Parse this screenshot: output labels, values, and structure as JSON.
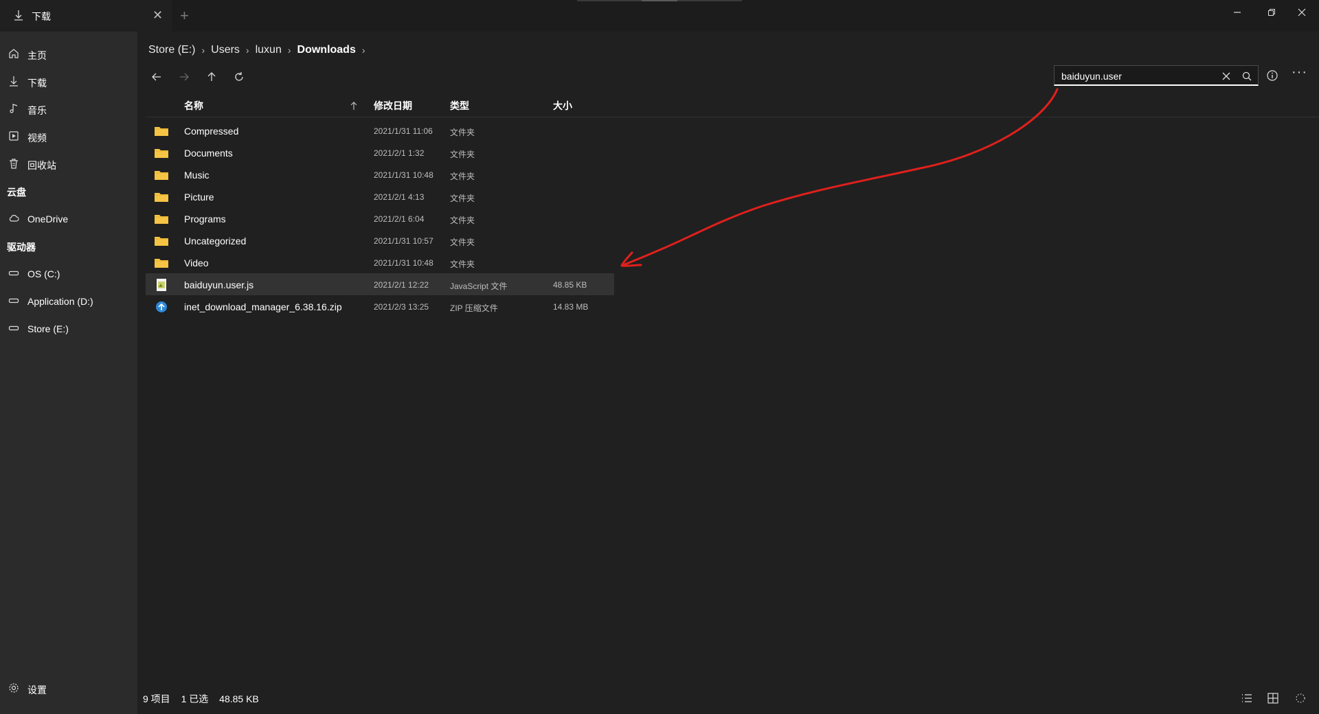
{
  "tab": {
    "title": "下载",
    "icon": "download-icon"
  },
  "window": {
    "minimize": "minimize-icon",
    "maximize": "restore-icon",
    "close": "close-icon"
  },
  "sidebar": {
    "items": [
      {
        "label": "主页",
        "icon": "home-icon"
      },
      {
        "label": "下载",
        "icon": "download-icon"
      },
      {
        "label": "音乐",
        "icon": "music-icon"
      },
      {
        "label": "视频",
        "icon": "video-icon"
      },
      {
        "label": "回收站",
        "icon": "recycle-bin-icon"
      }
    ],
    "cloud_header": "云盘",
    "cloud_items": [
      {
        "label": "OneDrive",
        "icon": "cloud-icon"
      }
    ],
    "drives_header": "驱动器",
    "drive_items": [
      {
        "label": "OS (C:)",
        "icon": "drive-icon"
      },
      {
        "label": "Application (D:)",
        "icon": "drive-icon"
      },
      {
        "label": "Store (E:)",
        "icon": "drive-icon"
      }
    ],
    "settings_label": "设置"
  },
  "breadcrumb": [
    "Store (E:)",
    "Users",
    "luxun",
    "Downloads"
  ],
  "search": {
    "value": "baiduyun.user"
  },
  "columns": {
    "name": "名称",
    "date": "修改日期",
    "type": "类型",
    "size": "大小"
  },
  "files": [
    {
      "name": "Compressed",
      "date": "2021/1/31 11:06",
      "type": "文件夹",
      "size": "",
      "kind": "folder"
    },
    {
      "name": "Documents",
      "date": "2021/2/1 1:32",
      "type": "文件夹",
      "size": "",
      "kind": "folder"
    },
    {
      "name": "Music",
      "date": "2021/1/31 10:48",
      "type": "文件夹",
      "size": "",
      "kind": "folder"
    },
    {
      "name": "Picture",
      "date": "2021/2/1 4:13",
      "type": "文件夹",
      "size": "",
      "kind": "folder"
    },
    {
      "name": "Programs",
      "date": "2021/2/1 6:04",
      "type": "文件夹",
      "size": "",
      "kind": "folder"
    },
    {
      "name": "Uncategorized",
      "date": "2021/1/31 10:57",
      "type": "文件夹",
      "size": "",
      "kind": "folder"
    },
    {
      "name": "Video",
      "date": "2021/1/31 10:48",
      "type": "文件夹",
      "size": "",
      "kind": "folder"
    },
    {
      "name": "baiduyun.user.js",
      "date": "2021/2/1 12:22",
      "type": "JavaScript 文件",
      "size": "48.85 KB",
      "kind": "js"
    },
    {
      "name": "inet_download_manager_6.38.16.zip",
      "date": "2021/2/3 13:25",
      "type": "ZIP 压缩文件",
      "size": "14.83 MB",
      "kind": "zip"
    }
  ],
  "status": {
    "items": "9 项目",
    "selected": "1 已选",
    "size": "48.85 KB"
  },
  "colors": {
    "accent": "#ffffff",
    "folder": "#f6c445",
    "annotation": "#e0201c",
    "background": "#202020",
    "sidebar": "#2b2b2b"
  }
}
